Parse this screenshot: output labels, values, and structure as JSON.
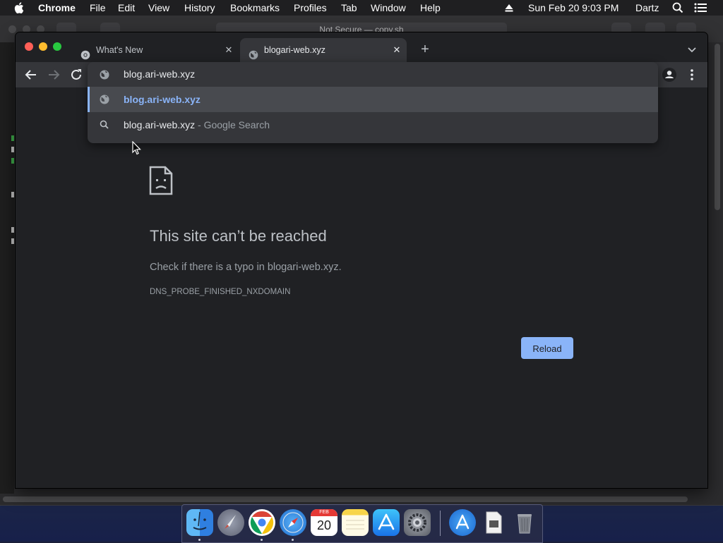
{
  "menubar": {
    "app_name": "Chrome",
    "items": [
      "File",
      "Edit",
      "View",
      "History",
      "Bookmarks",
      "Profiles",
      "Tab",
      "Window",
      "Help"
    ],
    "datetime": "Sun Feb 20  9:03 PM",
    "user": "Dartz"
  },
  "background_window": {
    "url_text": "Not Secure — copy.sh"
  },
  "tabs": [
    {
      "title": "What's New",
      "favicon": "chrome-logo-icon",
      "active": false
    },
    {
      "title": "blogari-web.xyz",
      "favicon": "globe-icon",
      "active": true
    }
  ],
  "omnibox": {
    "input_value": "blog.ari-web.xyz",
    "suggestions": [
      {
        "match": "blog.ari-web.xyz",
        "suffix": "",
        "icon": "globe-icon",
        "selected": true
      },
      {
        "match": "blog.ari-web.xyz",
        "suffix": " - Google Search",
        "icon": "search-icon",
        "selected": false
      }
    ]
  },
  "error_page": {
    "title": "This site can’t be reached",
    "message": "Check if there is a typo in blogari-web.xyz.",
    "code": "DNS_PROBE_FINISHED_NXDOMAIN",
    "reload_label": "Reload"
  },
  "dock": {
    "apps": [
      "finder-icon",
      "launchpad-icon",
      "chrome-icon",
      "safari-icon",
      "calendar-icon",
      "notes-icon",
      "app-store-icon",
      "system-preferences-icon",
      "app-store-downloads-icon",
      "document-icon",
      "trash-icon"
    ],
    "calendar_month": "FEB",
    "calendar_day": "20"
  },
  "colors": {
    "accent": "#8ab4f8",
    "window_bg": "#202124",
    "toolbar_bg": "#35363a",
    "close": "#ff5f57",
    "minimize": "#febc2e",
    "zoom": "#28c840"
  }
}
